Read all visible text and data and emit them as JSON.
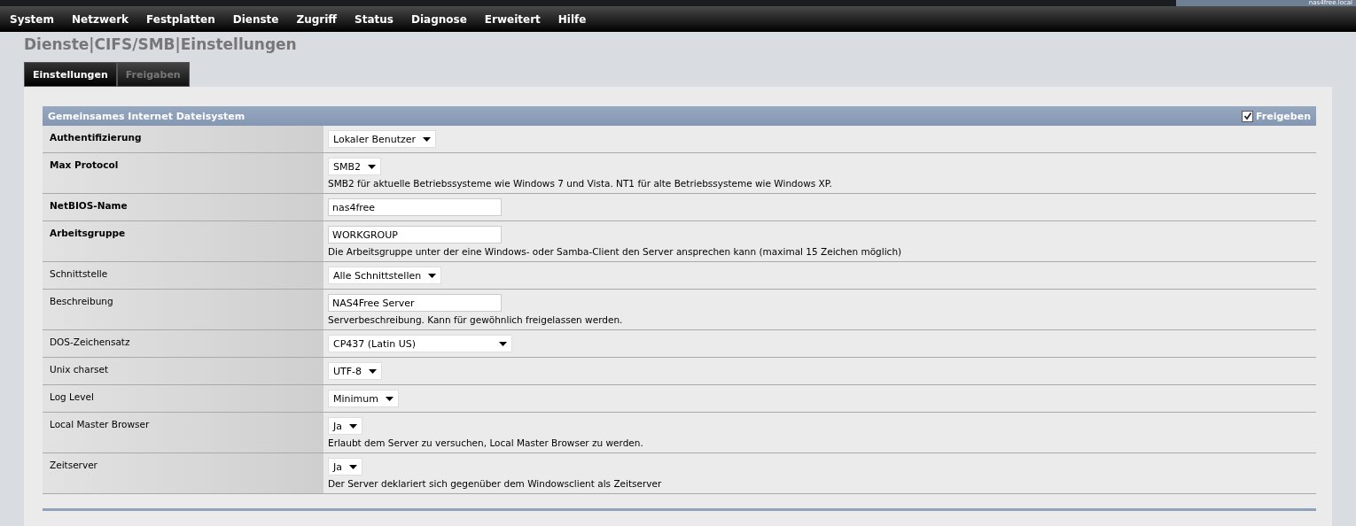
{
  "host": "nas4free.local",
  "menu": [
    "System",
    "Netzwerk",
    "Festplatten",
    "Dienste",
    "Zugriff",
    "Status",
    "Diagnose",
    "Erweitert",
    "Hilfe"
  ],
  "title": "Dienste|CIFS/SMB|Einstellungen",
  "tabs": [
    {
      "label": "Einstellungen",
      "selected": true
    },
    {
      "label": "Freigaben",
      "selected": false
    }
  ],
  "section": {
    "title": "Gemeinsames Internet Dateisystem",
    "enable": {
      "label": "Freigeben",
      "checked": true
    }
  },
  "rows": [
    {
      "label": "Authentifizierung",
      "required": true,
      "kind": "select",
      "value": "Lokaler Benutzer"
    },
    {
      "label": "Max Protocol",
      "required": true,
      "kind": "select",
      "value": "SMB2",
      "hint": "SMB2 für aktuelle Betriebssysteme wie Windows 7 und Vista. NT1 für alte Betriebssysteme wie Windows XP."
    },
    {
      "label": "NetBIOS-Name",
      "required": true,
      "kind": "input",
      "value": "nas4free"
    },
    {
      "label": "Arbeitsgruppe",
      "required": true,
      "kind": "input",
      "value": "WORKGROUP",
      "hint": "Die Arbeitsgruppe unter der eine Windows- oder Samba-Client den Server ansprechen kann (maximal 15 Zeichen möglich)"
    },
    {
      "label": "Schnittstelle",
      "required": false,
      "kind": "select",
      "value": "Alle Schnittstellen"
    },
    {
      "label": "Beschreibung",
      "required": false,
      "kind": "input",
      "value": "NAS4Free Server",
      "hint": "Serverbeschreibung. Kann für gewöhnlich freigelassen werden."
    },
    {
      "label": "DOS-Zeichensatz",
      "required": false,
      "kind": "select",
      "value": "CP437 (Latin US)",
      "wide": true
    },
    {
      "label": "Unix charset",
      "required": false,
      "kind": "select",
      "value": "UTF-8"
    },
    {
      "label": "Log Level",
      "required": false,
      "kind": "select",
      "value": "Minimum"
    },
    {
      "label": "Local Master Browser",
      "required": false,
      "kind": "select",
      "value": "Ja",
      "hint": "Erlaubt dem Server zu versuchen, Local Master Browser zu werden."
    },
    {
      "label": "Zeitserver",
      "required": false,
      "kind": "select",
      "value": "Ja",
      "hint": "Der Server deklariert sich gegenüber dem Windowsclient als Zeitserver"
    }
  ]
}
